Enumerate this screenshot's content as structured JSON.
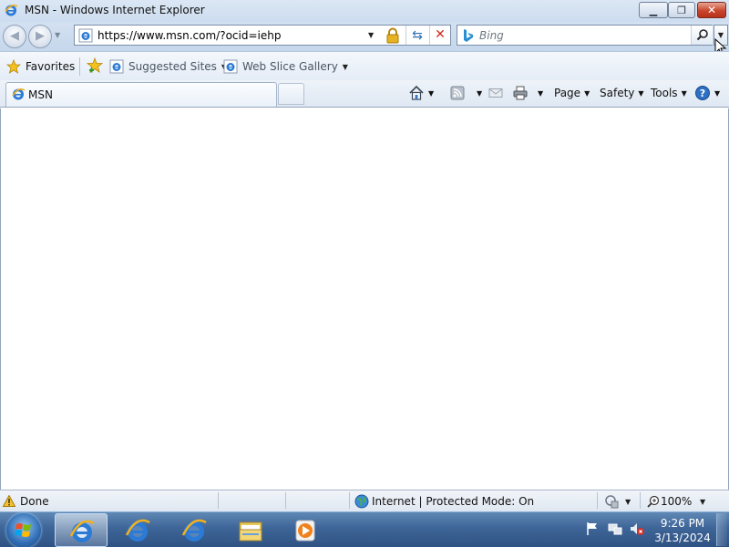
{
  "window": {
    "title": "MSN - Windows Internet Explorer",
    "minimize_icon": "minimize-icon",
    "maximize_icon": "maximize-icon",
    "close_icon": "close-icon"
  },
  "navigation": {
    "address_url": "https://www.msn.com/?ocid=iehp",
    "search_placeholder": "Bing"
  },
  "favorites_bar": {
    "favorites_label": "Favorites",
    "suggested_sites_label": "Suggested Sites",
    "web_slice_gallery_label": "Web Slice Gallery"
  },
  "tabs": [
    {
      "label": "MSN",
      "active": true
    }
  ],
  "command_bar": {
    "page_label": "Page",
    "safety_label": "Safety",
    "tools_label": "Tools"
  },
  "status_bar": {
    "status_text": "Done",
    "zone_text": "Internet | Protected Mode: On",
    "zoom_text": "100%"
  },
  "taskbar": {
    "clock_time": "9:26 PM",
    "clock_date": "3/13/2024"
  },
  "colors": {
    "title_bar": "#d5e3f3",
    "close_button": "#c8452c",
    "taskbar": "#3e6597"
  }
}
